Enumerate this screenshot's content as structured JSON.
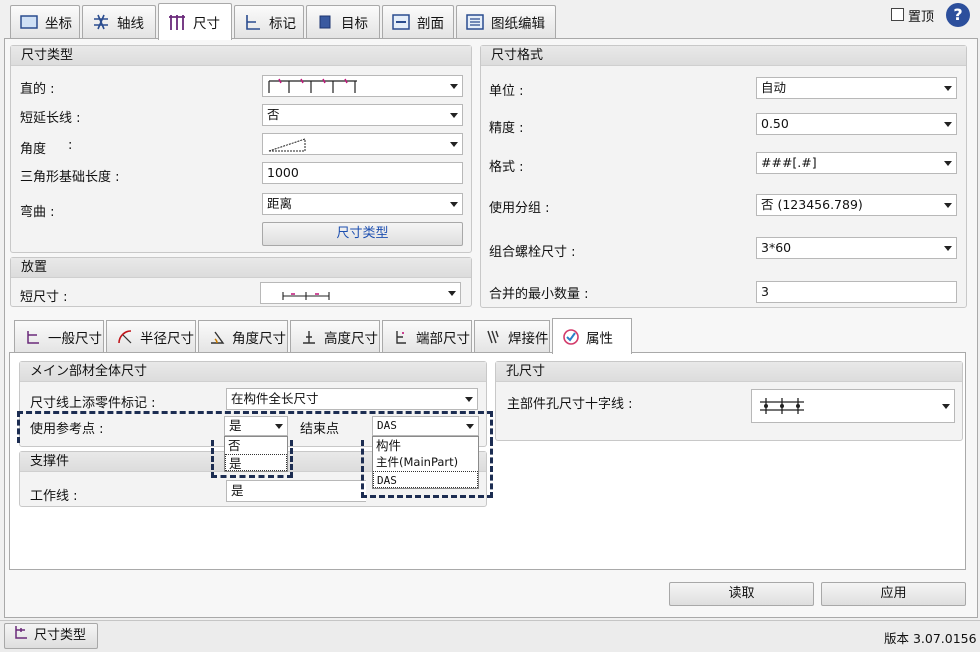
{
  "tabs": [
    "坐标",
    "轴线",
    "尺寸",
    "标记",
    "目标",
    "剖面",
    "图纸编辑"
  ],
  "pin_label": "置顶",
  "help_icon": "?",
  "dim_type": {
    "title": "尺寸类型",
    "straight_label": "直的 :",
    "short_ext_label": "短延长线 :",
    "short_ext_value": "否",
    "angle_label": "角度",
    "angle_colon": ":",
    "tri_label": "三角形基础长度 :",
    "tri_value": "1000",
    "bend_label": "弯曲 :",
    "bend_value": "距离",
    "button": "尺寸类型"
  },
  "placement": {
    "title": "放置",
    "short_dim_label": "短尺寸 :"
  },
  "dim_format": {
    "title": "尺寸格式",
    "unit_label": "单位 :",
    "unit_value": "自动",
    "precision_label": "精度 :",
    "precision_value": "0.50",
    "format_label": "格式 :",
    "format_value": "###[.#]",
    "group_label": "使用分组 :",
    "group_value": "否 (123456.789)",
    "bolt_label": "组合螺栓尺寸 :",
    "bolt_value": "3*60",
    "min_merge_label": "合并的最小数量 :",
    "min_merge_value": "3"
  },
  "sub_tabs": [
    "一般尺寸",
    "半径尺寸",
    "角度尺寸",
    "高度尺寸",
    "端部尺寸",
    "焊接件",
    "属性"
  ],
  "main_part": {
    "title": "メイン部材全体尺寸",
    "dim_line_label": "尺寸线上添零件标记 :",
    "dim_line_value": "在构件全长尺寸",
    "ref_point_label": "使用参考点 :",
    "ref_point_value": "是",
    "end_point_label": "结束点",
    "end_point_value": "DAS",
    "ref_options": [
      "否",
      "是"
    ],
    "end_options": [
      "构件",
      "主件(MainPart)",
      "DAS"
    ]
  },
  "support": {
    "title": "支撑件",
    "work_line_label": "工作线 :",
    "work_line_value": "是"
  },
  "hole": {
    "title": "孔尺寸",
    "cross_label": "主部件孔尺寸十字线 :"
  },
  "buttons": {
    "read": "读取",
    "apply": "应用"
  },
  "status": {
    "button": "尺寸类型",
    "version": "版本 3.07.0156"
  }
}
